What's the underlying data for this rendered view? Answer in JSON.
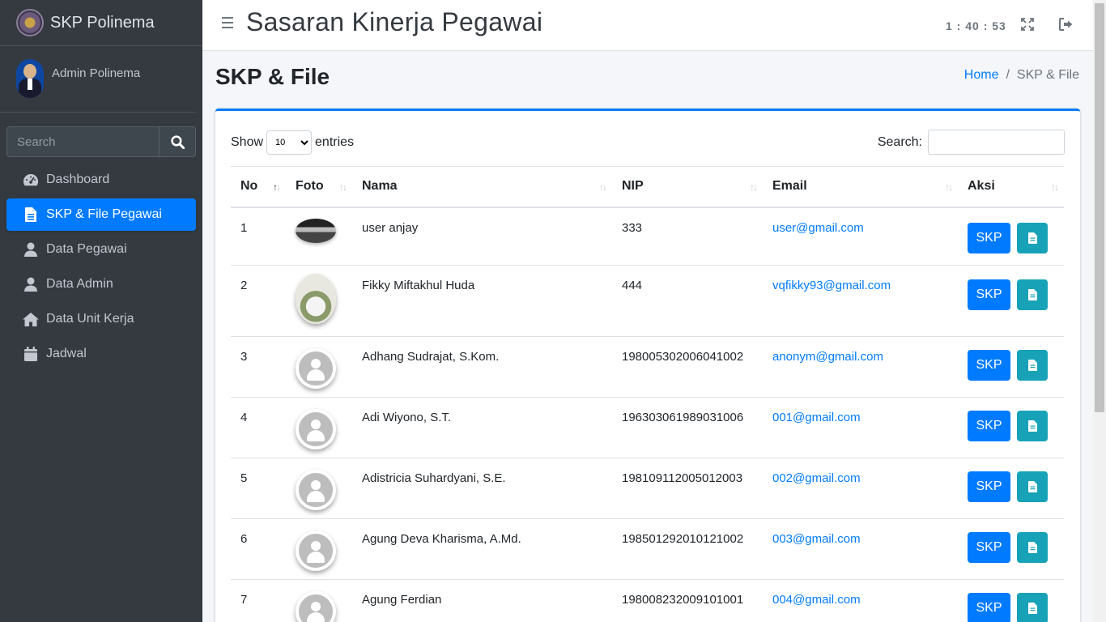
{
  "brand": {
    "name": "SKP Polinema",
    "logo_icon": "polinema-logo"
  },
  "user": {
    "name": "Admin Polinema"
  },
  "sidebar": {
    "search_placeholder": "Search",
    "items": [
      {
        "label": "Dashboard",
        "icon": "tachometer-icon",
        "active": false
      },
      {
        "label": "SKP & File Pegawai",
        "icon": "file-icon",
        "active": true
      },
      {
        "label": "Data Pegawai",
        "icon": "user-icon",
        "active": false
      },
      {
        "label": "Data Admin",
        "icon": "user-icon",
        "active": false
      },
      {
        "label": "Data Unit Kerja",
        "icon": "home-icon",
        "active": false
      },
      {
        "label": "Jadwal",
        "icon": "calendar-icon",
        "active": false
      }
    ]
  },
  "header": {
    "title": "Sasaran Kinerja Pegawai",
    "clock": "1 : 40 : 53"
  },
  "page": {
    "title": "SKP & File",
    "breadcrumb": {
      "home": "Home",
      "separator": "/",
      "current": "SKP & File"
    }
  },
  "table": {
    "show_label": "Show",
    "entries_label": "entries",
    "page_size": "10",
    "search_label": "Search:",
    "columns": [
      "No",
      "Foto",
      "Nama",
      "NIP",
      "Email",
      "Aksi"
    ],
    "skp_button": "SKP",
    "rows": [
      {
        "no": "1",
        "nama": "user anjay",
        "nip": "333",
        "email": "user@gmail.com"
      },
      {
        "no": "2",
        "nama": "Fikky Miftakhul Huda",
        "nip": "444",
        "email": "vqfikky93@gmail.com"
      },
      {
        "no": "3",
        "nama": "Adhang Sudrajat, S.Kom.",
        "nip": "198005302006041002",
        "email": "anonym@gmail.com"
      },
      {
        "no": "4",
        "nama": "Adi Wiyono, S.T.",
        "nip": "196303061989031006",
        "email": "001@gmail.com"
      },
      {
        "no": "5",
        "nama": "Adistricia Suhardyani, S.E.",
        "nip": "198109112005012003",
        "email": "002@gmail.com"
      },
      {
        "no": "6",
        "nama": "Agung Deva Kharisma, A.Md.",
        "nip": "198501292010121002",
        "email": "003@gmail.com"
      },
      {
        "no": "7",
        "nama": "Agung Ferdian",
        "nip": "198008232009101001",
        "email": "004@gmail.com"
      }
    ]
  },
  "colors": {
    "primary": "#007bff",
    "info": "#17a2b8",
    "sidebar": "#343a40"
  }
}
